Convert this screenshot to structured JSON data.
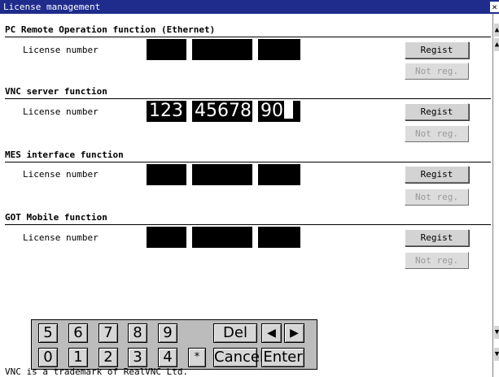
{
  "window": {
    "title": "License management",
    "close": "×"
  },
  "sections": [
    {
      "title": "PC Remote Operation function (Ethernet)",
      "label": "License number",
      "fields": [
        "",
        "",
        ""
      ],
      "regist": "Regist",
      "not_reg": "Not reg."
    },
    {
      "title": "VNC server function",
      "label": "License number",
      "fields": [
        "123",
        "45678",
        "90"
      ],
      "regist": "Regist",
      "not_reg": "Not reg."
    },
    {
      "title": "MES interface function",
      "label": "License number",
      "fields": [
        "",
        "",
        ""
      ],
      "regist": "Regist",
      "not_reg": "Not reg."
    },
    {
      "title": "GOT Mobile function",
      "label": "License number",
      "fields": [
        "",
        "",
        ""
      ],
      "regist": "Regist",
      "not_reg": "Not reg."
    }
  ],
  "keypad": {
    "row1": [
      "5",
      "6",
      "7",
      "8",
      "9"
    ],
    "row2": [
      "0",
      "1",
      "2",
      "3",
      "4"
    ],
    "del": "Del",
    "left": "◀",
    "right": "▶",
    "asterisk": "*",
    "cancel": "Cancel",
    "enter": "Enter"
  },
  "scrollbar": {
    "page_up": "▲",
    "line_up": "▲",
    "line_down": "▼",
    "page_down": "▼"
  },
  "trademark": "VNC is a trademark of RealVNC Ltd."
}
